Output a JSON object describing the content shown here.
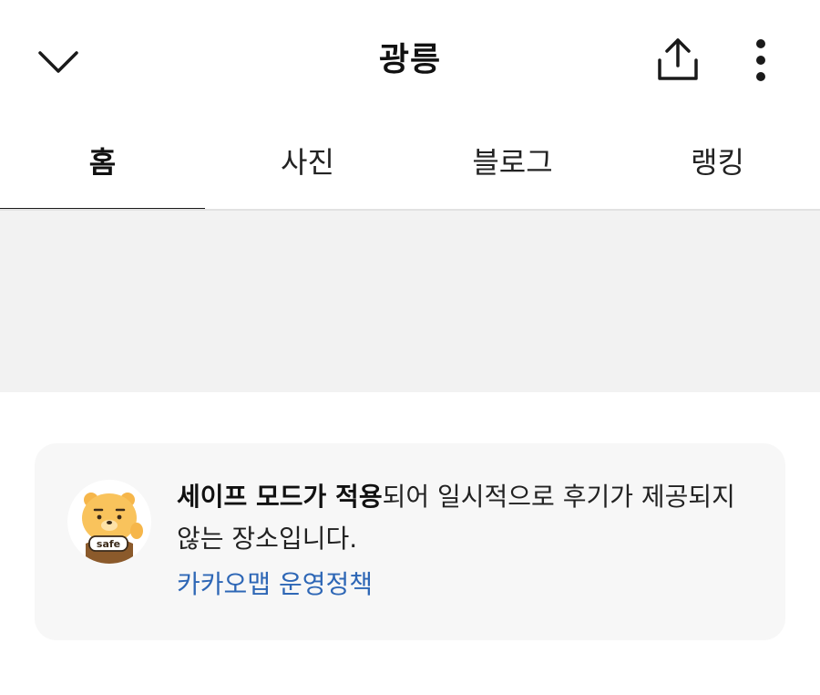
{
  "header": {
    "title": "광릉",
    "icons": {
      "back": "chevron-down-icon",
      "share": "share-icon",
      "more": "more-vertical-icon"
    }
  },
  "tabs": [
    {
      "label": "홈",
      "active": true
    },
    {
      "label": "사진",
      "active": false
    },
    {
      "label": "블로그",
      "active": false
    },
    {
      "label": "랭킹",
      "active": false
    }
  ],
  "notice": {
    "mascot_badge": "safe",
    "bold_text": "세이프 모드가 적용",
    "rest_text": "되어 일시적으로 후기가 제공되지 않는 장소입니다.",
    "link_label": "카카오맵 운영정책"
  },
  "colors": {
    "link": "#2e67b6",
    "card_bg": "#f7f7f7",
    "gray_area": "#f2f2f2",
    "active_tab_indicator": "#1a1a1a"
  }
}
